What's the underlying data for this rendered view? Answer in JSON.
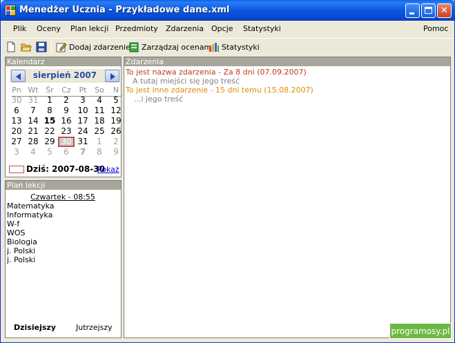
{
  "window": {
    "title": "Menedżer Ucznia - Przykładowe dane.xml"
  },
  "menu": [
    {
      "label": "Plik"
    },
    {
      "label": "Oceny"
    },
    {
      "label": "Plan lekcji"
    },
    {
      "label": "Przedmioty"
    },
    {
      "label": "Zdarzenia"
    },
    {
      "label": "Opcje"
    },
    {
      "label": "Statystyki"
    }
  ],
  "menu_help": "Pomoc",
  "toolbar": {
    "add_event": "Dodaj zdarzenie",
    "manage_grades": "Zarządzaj ocenami",
    "stats": "Statystyki"
  },
  "calendar": {
    "header": "Kalendarz",
    "month": "sierpień 2007",
    "weekdays": [
      "Pn",
      "Wt",
      "Śr",
      "Cz",
      "Pt",
      "So",
      "N"
    ],
    "weeks": [
      [
        "30",
        "31",
        "1",
        "2",
        "3",
        "4",
        "5"
      ],
      [
        "6",
        "7",
        "8",
        "9",
        "10",
        "11",
        "12"
      ],
      [
        "13",
        "14",
        "15",
        "16",
        "17",
        "18",
        "19"
      ],
      [
        "20",
        "21",
        "22",
        "23",
        "24",
        "25",
        "26"
      ],
      [
        "27",
        "28",
        "29",
        "30",
        "31",
        "1",
        "2"
      ],
      [
        "3",
        "4",
        "5",
        "6",
        "7",
        "8",
        "9"
      ]
    ],
    "today_label": "Dziś: 2007-08-30",
    "show_link": "Pokaż"
  },
  "plan": {
    "header": "Plan lekcji",
    "day": "Czwartek - 08:55",
    "lessons": [
      "Matematyka",
      "Informatyka",
      "W-f",
      "WOS",
      "Biologia",
      "j. Polski",
      "j. Polski"
    ],
    "tab_today": "Dzisiejszy",
    "tab_tomorrow": "Jutrzejszy"
  },
  "events": {
    "header": "Zdarzenia",
    "items": [
      {
        "title": "To jest nazwa zdarzenia - Za 8 dni (07.09.2007)",
        "body": "A tutaj miejści się jego treść",
        "color": "#c03a18"
      },
      {
        "title": "To jest inne zdarzenie - 15 dni temu (15.08.2007)",
        "body": "...i jego treść",
        "color": "#e08a00"
      }
    ]
  },
  "watermark": "programosy.pl"
}
